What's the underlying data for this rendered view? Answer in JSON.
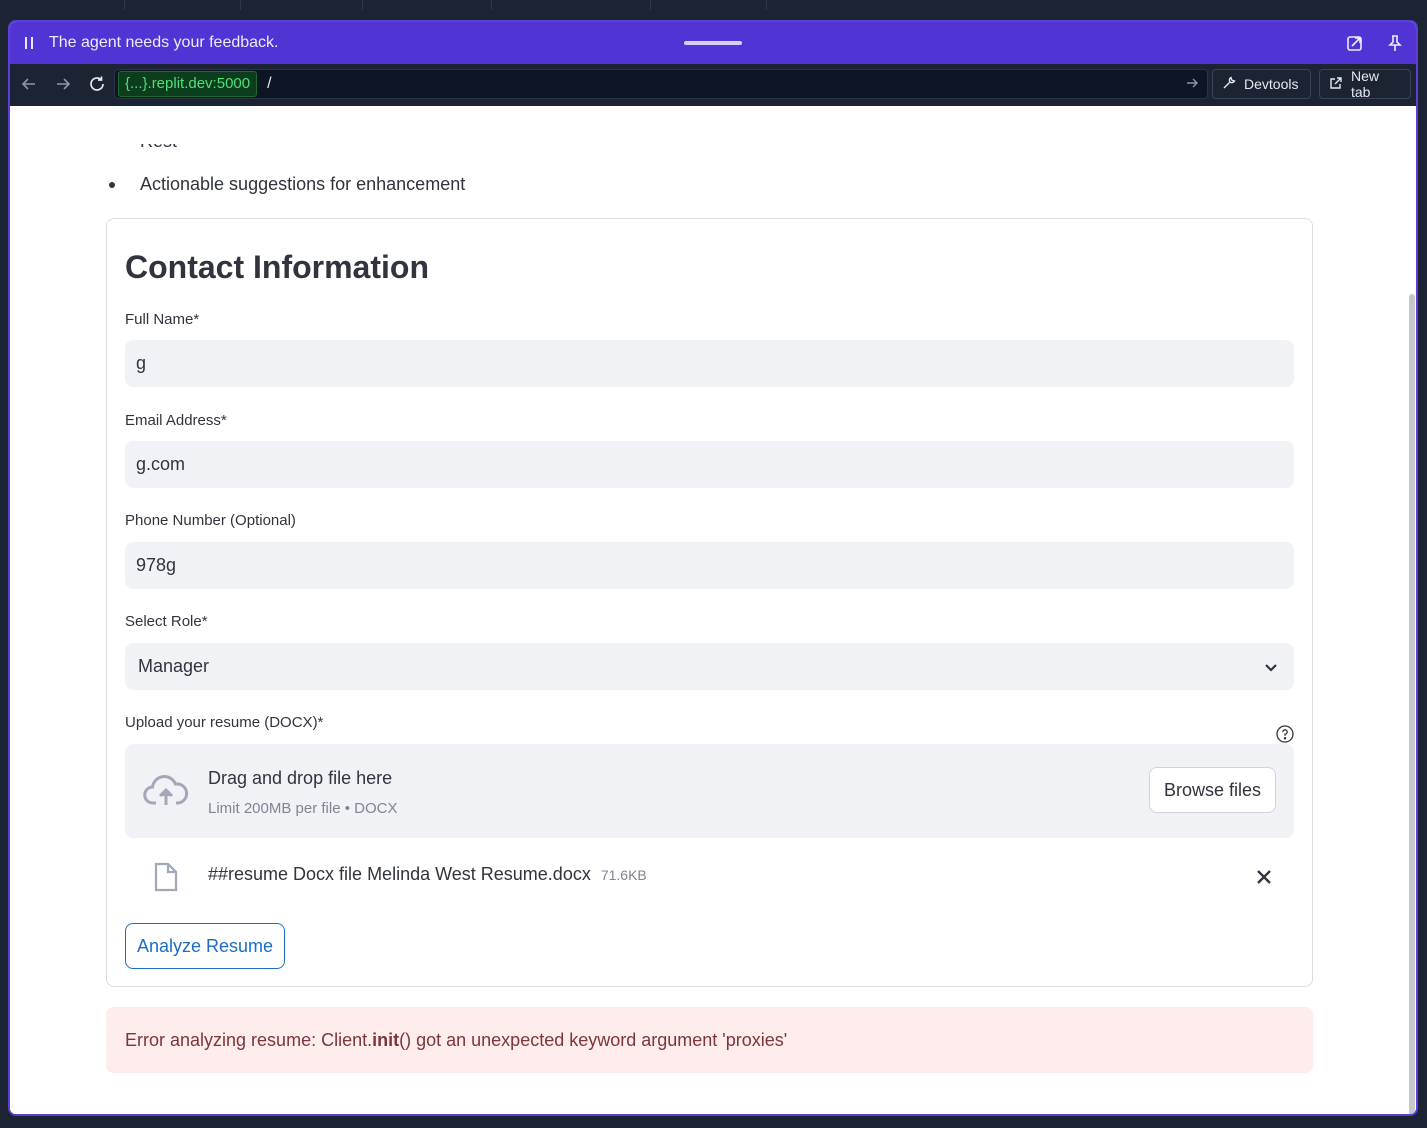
{
  "agent_bar": {
    "message": "The agent needs your feedback."
  },
  "browser": {
    "host": "{...}.replit.dev:5000",
    "path": "/",
    "devtools_label": "Devtools",
    "new_tab_label": "New tab"
  },
  "page": {
    "bullet_text": "Actionable suggestions for enhancement",
    "form": {
      "title": "Contact Information",
      "full_name": {
        "label": "Full Name*",
        "value": "g"
      },
      "email": {
        "label": "Email Address*",
        "value": "g.com"
      },
      "phone": {
        "label": "Phone Number (Optional)",
        "value": "978g"
      },
      "role": {
        "label": "Select Role*",
        "value": "Manager"
      },
      "upload": {
        "label": "Upload your resume (DOCX)*",
        "drop_title": "Drag and drop file here",
        "drop_limit": "Limit 200MB per file • DOCX",
        "browse_label": "Browse files",
        "file_name": "##resume Docx file Melinda West Resume.docx",
        "file_size": "71.6KB"
      },
      "analyze_label": "Analyze Resume"
    },
    "error": {
      "prefix": "Error analyzing resume: Client.",
      "bold": "init",
      "suffix": "() got an unexpected keyword argument 'proxies'"
    }
  },
  "colors": {
    "agent_bar": "#5234d4",
    "accent_blue": "#1c6dc5",
    "error_bg": "#ffecec",
    "error_text": "#7d353b"
  }
}
